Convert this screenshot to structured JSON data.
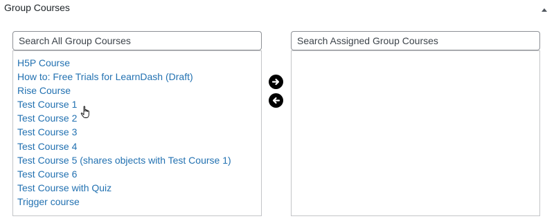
{
  "panel": {
    "title": "Group Courses"
  },
  "left": {
    "search_placeholder": "Search All Group Courses",
    "items": [
      "H5P Course",
      "How to: Free Trials for LearnDash (Draft)",
      "Rise Course",
      "Test Course 1",
      "Test Course 2",
      "Test Course 3",
      "Test Course 4",
      "Test Course 5 (shares objects with Test Course 1)",
      "Test Course 6",
      "Test Course with Quiz",
      "Trigger course"
    ]
  },
  "right": {
    "search_placeholder": "Search Assigned Group Courses",
    "items": []
  },
  "icons": {
    "collapse": "caret-up-icon",
    "move_right": "arrow-right-circle-icon",
    "move_left": "arrow-left-circle-icon",
    "cursor": "hand-pointer-icon"
  },
  "colors": {
    "link": "#2271b1",
    "border": "#c3c4c7",
    "input_border": "#8c8f94"
  }
}
